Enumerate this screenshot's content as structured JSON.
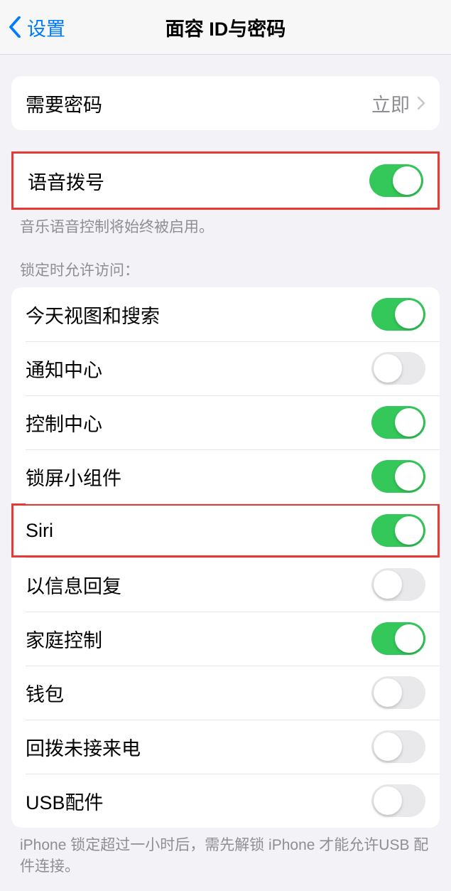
{
  "nav": {
    "back": "设置",
    "title": "面容 ID与密码"
  },
  "require_passcode": {
    "label": "需要密码",
    "value": "立即"
  },
  "voice_dial": {
    "label": "语音拨号",
    "note": "音乐语音控制将始终被启用。"
  },
  "lock_access": {
    "header": "锁定时允许访问：",
    "items": [
      {
        "label": "今天视图和搜索",
        "on": true
      },
      {
        "label": "通知中心",
        "on": false
      },
      {
        "label": "控制中心",
        "on": true
      },
      {
        "label": "锁屏小组件",
        "on": true
      },
      {
        "label": "Siri",
        "on": true,
        "highlight": true
      },
      {
        "label": "以信息回复",
        "on": false
      },
      {
        "label": "家庭控制",
        "on": true
      },
      {
        "label": "钱包",
        "on": false
      },
      {
        "label": "回拨未接来电",
        "on": false
      },
      {
        "label": "USB配件",
        "on": false
      }
    ],
    "footer": "iPhone 锁定超过一小时后，需先解锁 iPhone 才能允许USB 配件连接。"
  }
}
